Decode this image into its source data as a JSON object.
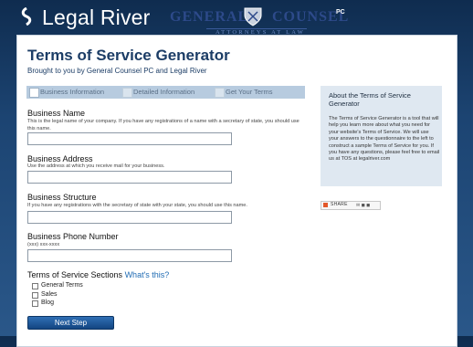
{
  "header": {
    "site_name": "Legal River",
    "partner_left": "GENERAL",
    "partner_right": "COUNSEL",
    "partner_suffix": "PC",
    "partner_tagline": "ATTORNEYS AT LAW"
  },
  "page": {
    "title": "Terms of Service Generator",
    "subtitle": "Brought to you by General Counsel PC and Legal River"
  },
  "steps": [
    {
      "label": "Business Information",
      "active": true
    },
    {
      "label": "Detailed Information",
      "active": false
    },
    {
      "label": "Get Your Terms",
      "active": false
    }
  ],
  "fields": {
    "name": {
      "label": "Business Name",
      "help": "This is the legal name of your company. If you have any registrations of a name with a secretary of state, you should use this name.",
      "value": ""
    },
    "address": {
      "label": "Business Address",
      "help": "Use the address at which you receive mail for your business.",
      "value": ""
    },
    "structure": {
      "label": "Business Structure",
      "help": "If you have any registrations with the secretary of state with your state, you should use this name.",
      "value": ""
    },
    "phone": {
      "label": "Business Phone Number",
      "help": "(xxx) xxx-xxxx",
      "value": ""
    }
  },
  "sections": {
    "label": "Terms of Service Sections",
    "link": "What's this?",
    "options": [
      "General Terms",
      "Sales",
      "Blog"
    ]
  },
  "next_button": "Next Step",
  "about": {
    "title": "About the Terms of Service Generator",
    "body": "The Terms of Service Generator is a tool that will help you learn more about what you need for your website's Terms of Service. We will use your answers to the questionnaire to the left to construct a sample Terms of Service for you. If you have any questions, please feel free to email us at TOS at legalriver.com"
  },
  "share": {
    "label": "SHARE"
  },
  "colors": {
    "background": "#1c4472",
    "heading": "#1c3d66",
    "step_bar": "#b7cbdf",
    "sidebar": "#dfe8f1",
    "button": "#1f5aa0",
    "link": "#1f6bb3"
  }
}
